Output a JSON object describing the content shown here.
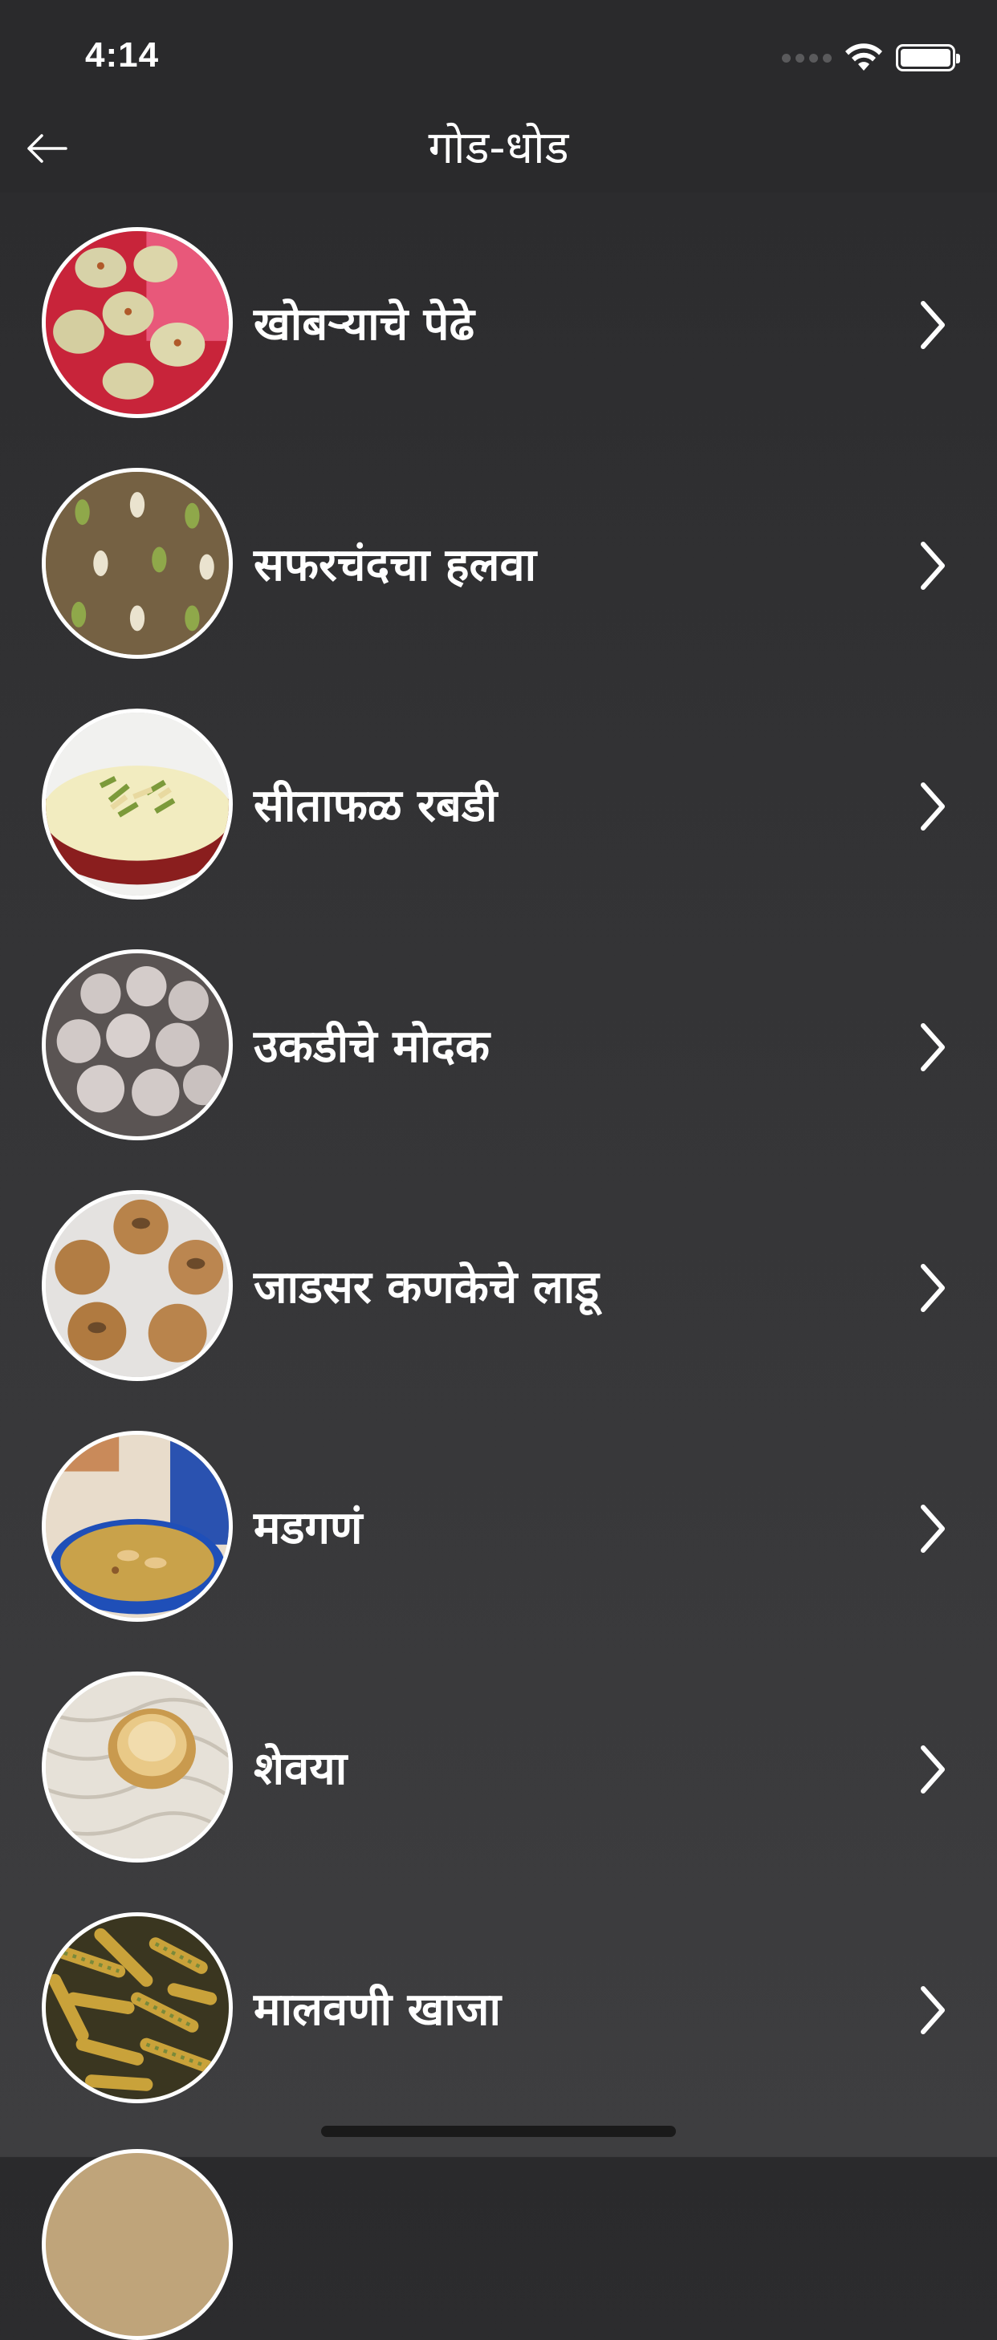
{
  "status": {
    "time": "4:14"
  },
  "header": {
    "title": "गोड-धोड"
  },
  "items": [
    {
      "label": "खोबऱ्याचे पेढे"
    },
    {
      "label": "सफरचंदचा हलवा"
    },
    {
      "label": "सीताफळ रबडी"
    },
    {
      "label": "उकडीचे मोदक"
    },
    {
      "label": "जाडसर कणकेचे लाडू"
    },
    {
      "label": "मडगणं"
    },
    {
      "label": "शेवया"
    },
    {
      "label": "मालवणी खाजा"
    }
  ],
  "colors": {
    "background": "#333335",
    "text": "#ffffff",
    "thumb_border": "#ffffff"
  }
}
